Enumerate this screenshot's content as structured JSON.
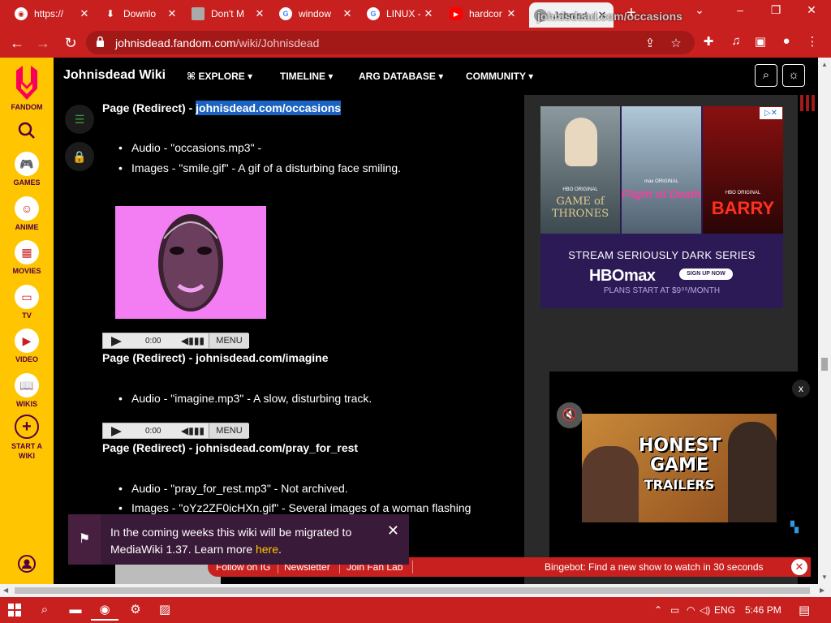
{
  "browser": {
    "tabs": [
      {
        "label": "https://",
        "icon": "wiki-icon"
      },
      {
        "label": "Downlo",
        "icon": "download-icon"
      },
      {
        "label": "Don't M",
        "icon": "roblox-icon"
      },
      {
        "label": "window",
        "icon": "google-icon"
      },
      {
        "label": "LINUX -",
        "icon": "google-icon"
      },
      {
        "label": "hardcor",
        "icon": "youtube-icon"
      },
      {
        "label": "Johnisd",
        "icon": "fandom-icon",
        "active": true
      }
    ],
    "dragged_link": "johnisdead.com/occasions",
    "url_domain": "johnisdead.fandom.com",
    "url_path": "/wiki/Johnisdead"
  },
  "sidebar": {
    "logo_label": "FANDOM",
    "items": [
      {
        "label": "GAMES",
        "icon": "gamepad-icon"
      },
      {
        "label": "ANIME",
        "icon": "anime-icon"
      },
      {
        "label": "MOVIES",
        "icon": "clapper-icon"
      },
      {
        "label": "TV",
        "icon": "tv-icon"
      },
      {
        "label": "VIDEO",
        "icon": "play-icon"
      },
      {
        "label": "WIKIS",
        "icon": "book-icon"
      },
      {
        "label": "START A WIKI",
        "icon": "plus-icon"
      }
    ]
  },
  "header": {
    "wiki_name": "Johnisdead Wiki",
    "nav": [
      "EXPLORE",
      "TIMELINE",
      "ARG DATABASE",
      "COMMUNITY"
    ]
  },
  "content": {
    "sections": [
      {
        "heading_prefix": "Page (Redirect) - ",
        "heading_link": "johnisdead.com/occasions",
        "bullets": [
          "Audio - \"occasions.mp3\" -",
          "Images - \"smile.gif\" - A gif of a disturbing face smiling."
        ]
      },
      {
        "heading": "Page (Redirect) - johnisdead.com/imagine",
        "bullets": [
          "Audio - \"imagine.mp3\" - A slow, disturbing track."
        ]
      },
      {
        "heading": "Page (Redirect) - johnisdead.com/pray_for_rest",
        "bullets": [
          "Audio - \"pray_for_rest.mp3\" - Not archived.",
          "Images - \"oYz2ZF0icHXn.gif\" - Several images of a woman flashing"
        ]
      }
    ],
    "audio_player": {
      "time": "0:00",
      "menu": "MENU"
    }
  },
  "ad_hbo": {
    "posters": [
      {
        "brand": "HBO ORIGINAL",
        "title": "GAME of THRONES"
      },
      {
        "brand": "max ORIGINAL",
        "title": "Flight of Death"
      },
      {
        "brand": "HBO ORIGINAL",
        "title": "BARRY"
      }
    ],
    "headline": "STREAM SERIOUSLY DARK SERIES",
    "brand": "HBOmax",
    "cta": "SIGN UP NOW",
    "price": "PLANS START AT $9⁹⁹/MONTH"
  },
  "video_ad": {
    "close": "x",
    "title_line1": "HONEST",
    "title_line2": "GAME",
    "title_line3": "TRAILERS"
  },
  "notification": {
    "text": "In the coming weeks this wiki will be migrated to MediaWiki 1.37. Learn more ",
    "link": "here",
    "suffix": "."
  },
  "fanbar": {
    "links": [
      "Follow on IG",
      "Newsletter",
      "Join Fan Lab"
    ],
    "bingebot": "Bingebot: Find a new show to watch in 30 seconds"
  },
  "taskbar": {
    "lang": "ENG",
    "time": "5:46 PM"
  }
}
